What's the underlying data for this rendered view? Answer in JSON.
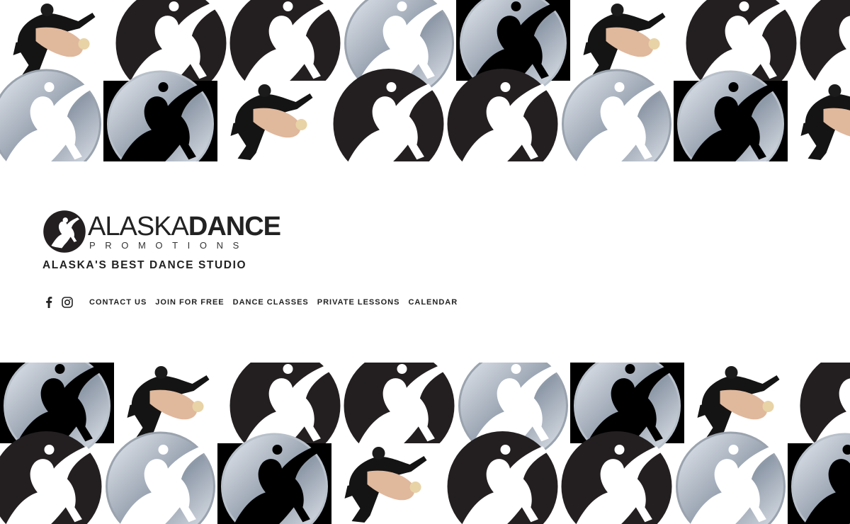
{
  "brand": {
    "word_thin": "ALASKA",
    "word_bold": "DANCE",
    "word_sub": "PROMOTIONS",
    "tagline": "ALASKA'S BEST DANCE STUDIO"
  },
  "social": [
    {
      "name": "facebook-icon"
    },
    {
      "name": "instagram-icon"
    }
  ],
  "nav": {
    "items": [
      {
        "label": "CONTACT US"
      },
      {
        "label": "JOIN FOR FREE"
      },
      {
        "label": "DANCE CLASSES"
      },
      {
        "label": "PRIVATE LESSONS"
      },
      {
        "label": "CALENDAR"
      }
    ]
  },
  "mosaic": {
    "top": [
      [
        "couple",
        "dark",
        "dark",
        "silver",
        "black-silver",
        "couple",
        "dark",
        "dark"
      ],
      [
        "silver",
        "black-silver",
        "couple",
        "dark",
        "dark",
        "silver",
        "black-silver",
        "couple"
      ]
    ],
    "bottom": [
      [
        "black-silver",
        "couple",
        "dark",
        "dark",
        "silver",
        "black-silver",
        "couple",
        "dark"
      ],
      [
        "dark",
        "silver",
        "black-silver",
        "couple",
        "dark",
        "dark",
        "silver",
        "black-silver"
      ]
    ]
  },
  "colors": {
    "text": "#222222",
    "dark_tile": "#231f20",
    "silver_light": "#e9edf3",
    "silver_dark": "#8e99a8"
  }
}
